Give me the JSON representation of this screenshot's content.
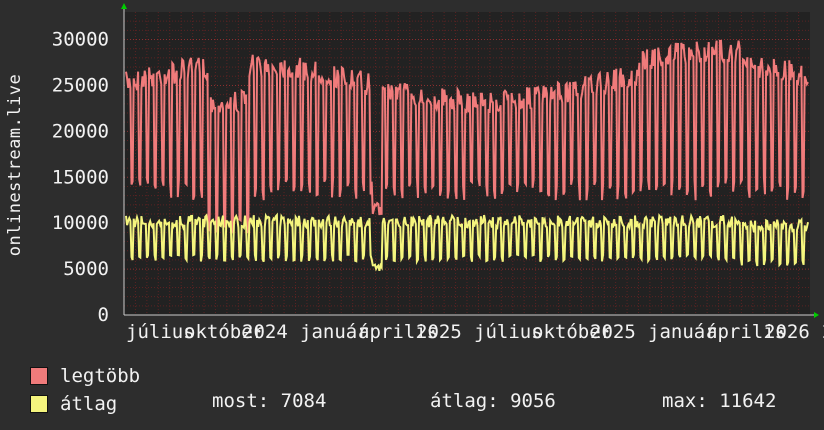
{
  "chart_data": {
    "type": "line",
    "ylabel": "onlinestream.live",
    "ylim": [
      0,
      33000
    ],
    "yticks": [
      0,
      5000,
      10000,
      15000,
      20000,
      25000,
      30000
    ],
    "xtick_labels": [
      "július",
      "október",
      "2024",
      "január",
      "április",
      "2025",
      "július",
      "október",
      "2025",
      "január",
      "április",
      "2026",
      "2"
    ],
    "grid": true,
    "series": [
      {
        "name": "legtöbb",
        "color": "#f07b7b"
      },
      {
        "name": "átlag",
        "color": "#f5f57e"
      }
    ]
  },
  "legend": {
    "max_label": "legtöbb",
    "avg_label": "átlag",
    "max_color": "#f07b7b",
    "avg_color": "#f5f57e"
  },
  "stats": {
    "most": "most: 7084",
    "atlag": "átlag: 9056",
    "max": "max: 11642"
  },
  "colors": {
    "background": "#2d2d2d",
    "plot": "#222222",
    "grid": "#ff0000",
    "axis_arrow": "#00cc00"
  }
}
